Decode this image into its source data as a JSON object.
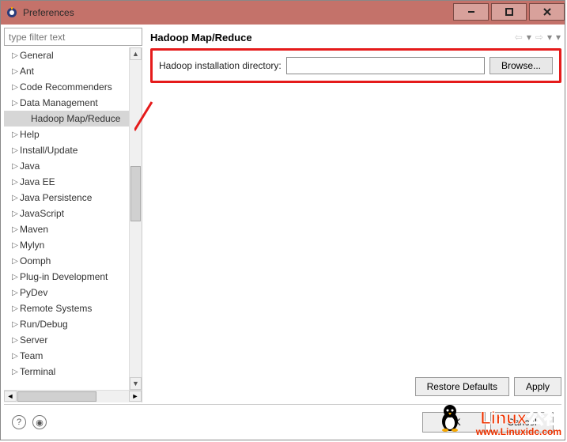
{
  "titlebar": {
    "title": "Preferences"
  },
  "filter": {
    "placeholder": "type filter text"
  },
  "tree": {
    "items": [
      {
        "label": "General",
        "expandable": true
      },
      {
        "label": "Ant",
        "expandable": true
      },
      {
        "label": "Code Recommenders",
        "expandable": true
      },
      {
        "label": "Data Management",
        "expandable": true
      },
      {
        "label": "Hadoop Map/Reduce",
        "expandable": false,
        "selected": true,
        "child": true
      },
      {
        "label": "Help",
        "expandable": true
      },
      {
        "label": "Install/Update",
        "expandable": true
      },
      {
        "label": "Java",
        "expandable": true
      },
      {
        "label": "Java EE",
        "expandable": true
      },
      {
        "label": "Java Persistence",
        "expandable": true
      },
      {
        "label": "JavaScript",
        "expandable": true
      },
      {
        "label": "Maven",
        "expandable": true
      },
      {
        "label": "Mylyn",
        "expandable": true
      },
      {
        "label": "Oomph",
        "expandable": true
      },
      {
        "label": "Plug-in Development",
        "expandable": true
      },
      {
        "label": "PyDev",
        "expandable": true
      },
      {
        "label": "Remote Systems",
        "expandable": true
      },
      {
        "label": "Run/Debug",
        "expandable": true
      },
      {
        "label": "Server",
        "expandable": true
      },
      {
        "label": "Team",
        "expandable": true
      },
      {
        "label": "Terminal",
        "expandable": true
      }
    ]
  },
  "page": {
    "title": "Hadoop Map/Reduce",
    "field_label": "Hadoop installation directory:",
    "field_value": "",
    "browse_label": "Browse...",
    "restore_label": "Restore Defaults",
    "apply_label": "Apply"
  },
  "bottom": {
    "ok_label": "OK",
    "cancel_label": "Cancel"
  },
  "watermark": {
    "line1a": "Linux",
    "line1b": "公社",
    "line2": "www.Linuxidc.com"
  }
}
